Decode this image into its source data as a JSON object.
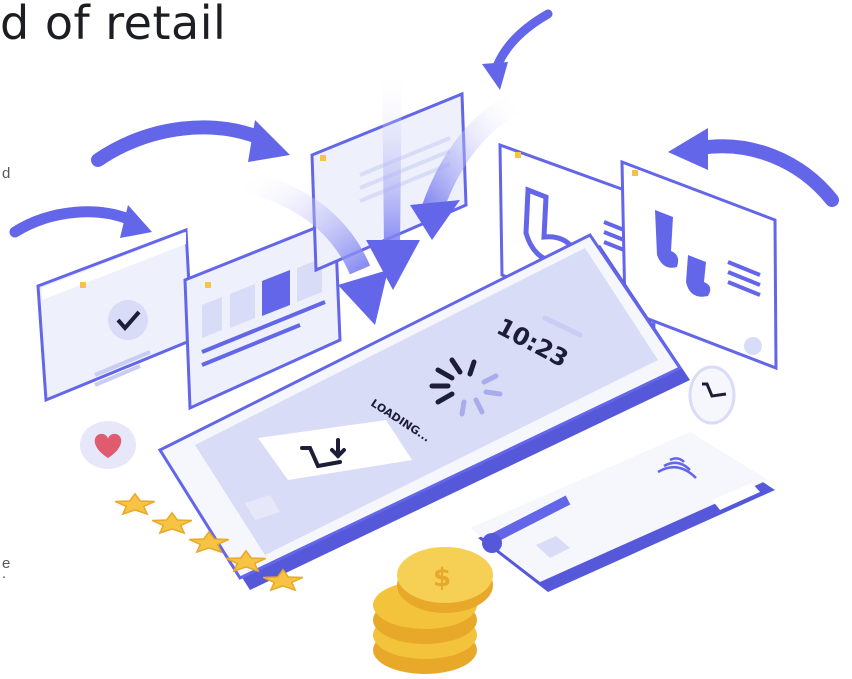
{
  "page": {
    "heading_fragment": "d of retail",
    "side_text_fragments": [
      "d",
      "e",
      "."
    ]
  },
  "illustration": {
    "phone_clock": "10:23",
    "loading_label": "LOADING...",
    "rating_stars": 5,
    "coin_symbol": "$",
    "icons": [
      "checkmark-icon",
      "heart-icon",
      "cart-download-icon",
      "contactless-icon",
      "plus-icon",
      "sock-icon",
      "star-icon",
      "coin-icon"
    ],
    "colors": {
      "accent": "#6366e8",
      "panel": "#eef0fb",
      "star": "#f6c342",
      "coin": "#f3c33c"
    }
  }
}
